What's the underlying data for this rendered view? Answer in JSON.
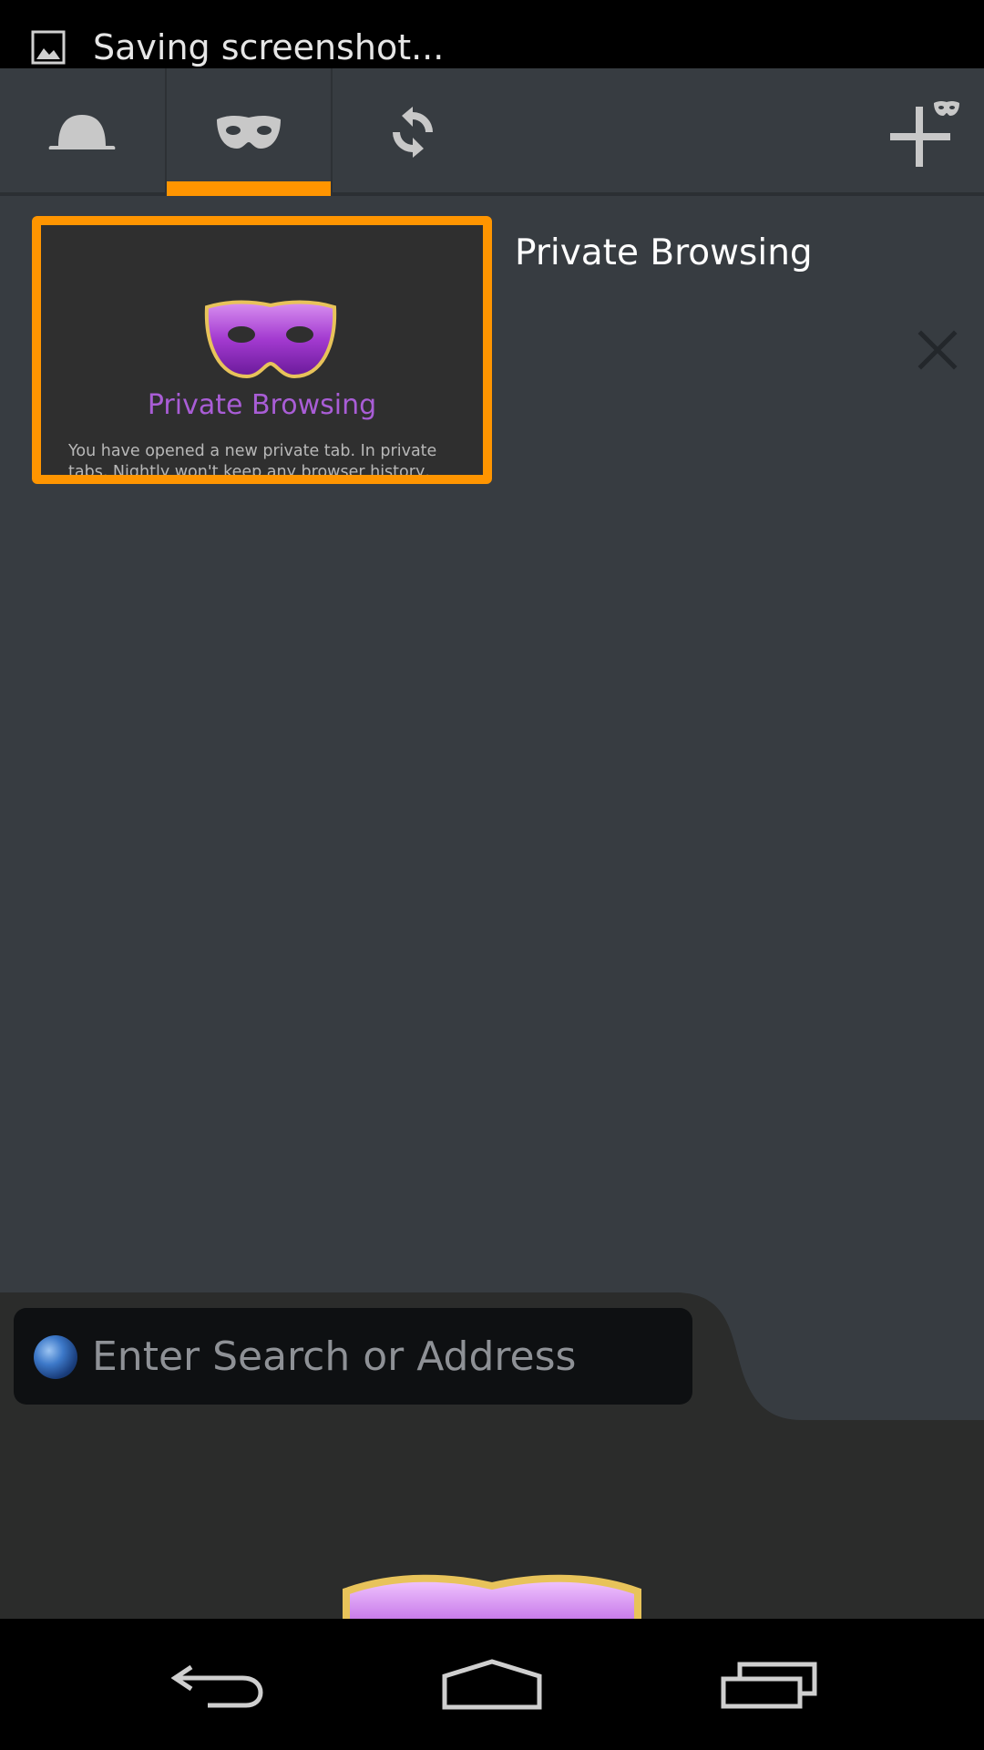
{
  "status_bar": {
    "notification_text": "Saving screenshot..."
  },
  "tabs_panel": {
    "tabs": [
      {
        "name": "normal-tabs",
        "icon": "hat-icon"
      },
      {
        "name": "private-tabs",
        "icon": "mask-icon",
        "selected": true
      },
      {
        "name": "synced-tabs",
        "icon": "sync-icon"
      }
    ],
    "new_tab_icon": "new-private-tab-icon",
    "open_tabs": [
      {
        "title": "Private Browsing",
        "thumbnail": {
          "heading": "Private Browsing",
          "body": "You have opened a new private tab. In private tabs, Nightly won't keep any browser history, search"
        }
      }
    ]
  },
  "url_bar": {
    "placeholder": "Enter Search or Address"
  },
  "colors": {
    "accent": "#ff9500",
    "panel_bg": "#373c41",
    "private_purple": "#a95dd6"
  }
}
